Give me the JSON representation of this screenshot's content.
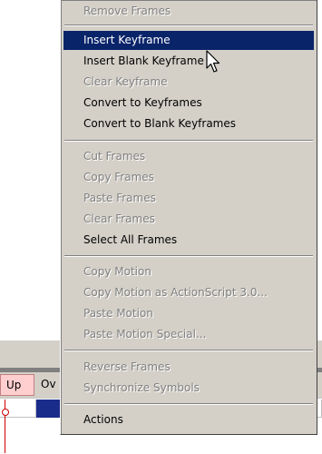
{
  "menu": {
    "items": [
      {
        "label": "Remove Frames",
        "enabled": false
      },
      {
        "label": "Insert Keyframe",
        "enabled": true,
        "highlighted": true
      },
      {
        "label": "Insert Blank Keyframe",
        "enabled": true
      },
      {
        "label": "Clear Keyframe",
        "enabled": false
      },
      {
        "label": "Convert to Keyframes",
        "enabled": true
      },
      {
        "label": "Convert to Blank Keyframes",
        "enabled": true
      },
      {
        "label": "Cut Frames",
        "enabled": false
      },
      {
        "label": "Copy Frames",
        "enabled": false
      },
      {
        "label": "Paste Frames",
        "enabled": false
      },
      {
        "label": "Clear Frames",
        "enabled": false
      },
      {
        "label": "Select All Frames",
        "enabled": true
      },
      {
        "label": "Copy Motion",
        "enabled": false
      },
      {
        "label": "Copy Motion as ActionScript 3.0...",
        "enabled": false
      },
      {
        "label": "Paste Motion",
        "enabled": false
      },
      {
        "label": "Paste Motion Special...",
        "enabled": false
      },
      {
        "label": "Reverse Frames",
        "enabled": false
      },
      {
        "label": "Synchronize Symbols",
        "enabled": false
      },
      {
        "label": "Actions",
        "enabled": true
      }
    ]
  },
  "timeline": {
    "tab_up": "Up",
    "tab_ov": "Ov"
  },
  "colors": {
    "highlight": "#0a246a",
    "menu_bg": "#d4d0c8",
    "disabled_text": "#808080",
    "playhead": "#cc0000"
  },
  "icons": {
    "cursor": "arrow-cursor-icon"
  }
}
